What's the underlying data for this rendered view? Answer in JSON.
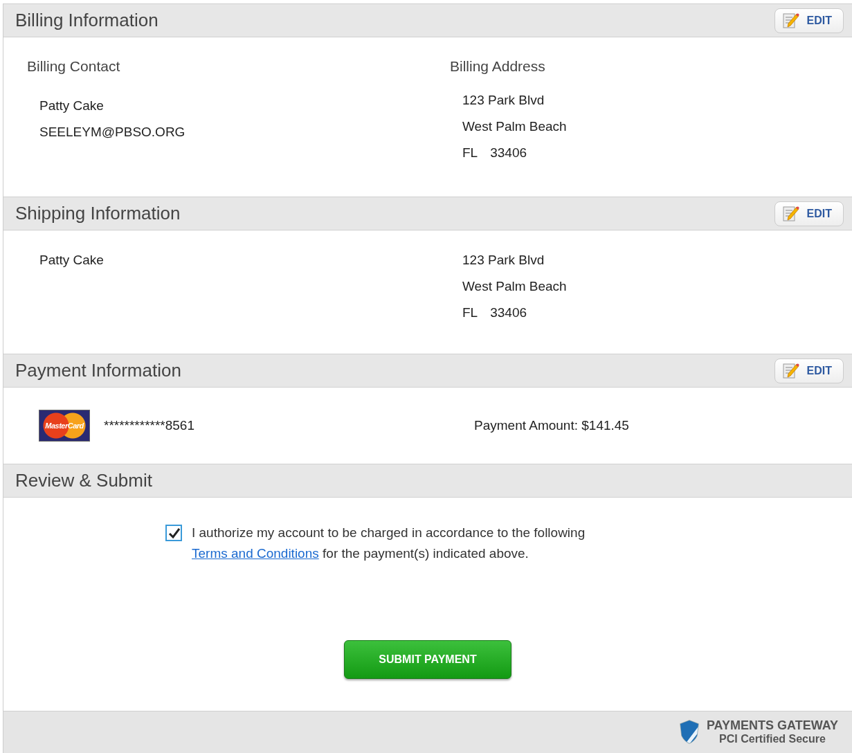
{
  "sections": [
    {
      "kind": "contact",
      "title": "Billing Information",
      "edit": "EDIT",
      "left": {
        "heading": "Billing Contact",
        "name": "Patty Cake",
        "email": "SEELEYM@PBSO.ORG"
      },
      "right": {
        "heading": "Billing Address",
        "street": "123 Park Blvd",
        "city": "West Palm Beach",
        "state": "FL",
        "zip": "33406"
      }
    },
    {
      "kind": "contact",
      "title": "Shipping Information",
      "edit": "EDIT",
      "left": {
        "name": "Patty Cake"
      },
      "right": {
        "street": "123 Park Blvd",
        "city": "West Palm Beach",
        "state": "FL",
        "zip": "33406"
      }
    },
    {
      "kind": "payment",
      "title": "Payment Information",
      "edit": "EDIT",
      "card_brand": "MasterCard",
      "card_number": "************8561",
      "amount": "Payment Amount: $141.45"
    },
    {
      "kind": "review",
      "title": "Review & Submit",
      "authorize": {
        "checked": true,
        "text_before": "I authorize my account to be charged in accordance to the following",
        "link": "Terms and Conditions",
        "text_after": "for the payment(s) indicated above."
      },
      "submit": "SUBMIT PAYMENT"
    }
  ],
  "footer": {
    "brand": "PAYMENTS GATEWAY",
    "tagline": "PCI Certified Secure"
  }
}
